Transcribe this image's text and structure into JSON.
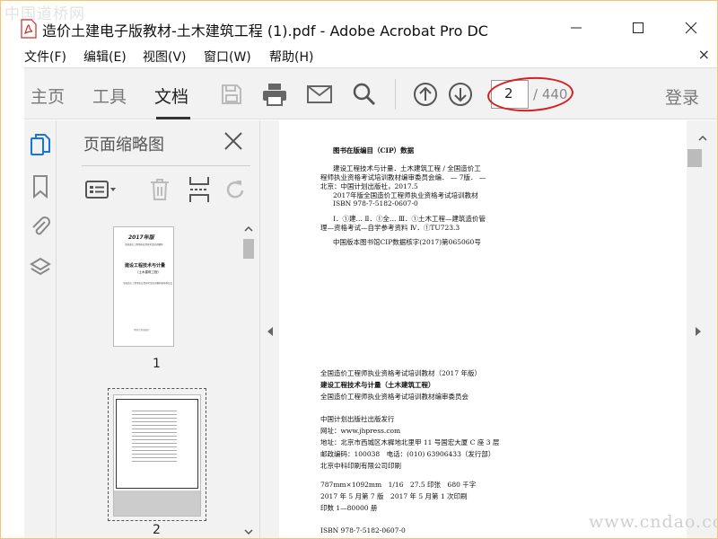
{
  "watermark_top": "中国道桥网",
  "watermark_bottom": "www.cndao.com",
  "window": {
    "title": "造价土建电子版教材-土木建筑工程 (1).pdf - Adobe Acrobat Pro DC"
  },
  "menu": [
    {
      "label": "文件(F)"
    },
    {
      "label": "编辑(E)"
    },
    {
      "label": "视图(V)"
    },
    {
      "label": "窗口(W)"
    },
    {
      "label": "帮助(H)"
    }
  ],
  "menu_close": "×",
  "toolbar": {
    "tabs": [
      {
        "label": "主页"
      },
      {
        "label": "工具"
      },
      {
        "label": "文档"
      }
    ],
    "active_tab": "文档",
    "page_value": "2",
    "page_total": "/ 440",
    "login_label": "登录"
  },
  "sidebar": {
    "title": "页面缩略图"
  },
  "thumbnails": [
    {
      "number": "1",
      "lines": {
        "year": "2017年版",
        "series": "全国造价工程师执业资格考试培训教材",
        "title": "建设工程技术与计量",
        "subtitle": "（土木建筑工程）",
        "note": "全国造价工程师执业资格考试培训教材编审委员会",
        "publisher": "中国计划出版社"
      }
    },
    {
      "number": "2"
    }
  ],
  "document": {
    "lines": [
      "图书在版编目（CIP）数据",
      "建设工程技术与计量．土木建筑工程 / 全国造价工",
      "程师执业资格考试培训教材编审委员会编． — 7版． —",
      "北京：中国计划出版社，2017.5",
      "2017年版全国造价工程师执业资格考试培训教材",
      "ISBN 978-7-5182-0607-0",
      "Ⅰ．①建… Ⅱ．①全… Ⅲ．①土木工程—建筑造价管",
      "理—资格考试—自学参考资料 Ⅳ．①TU723.3",
      "中国版本图书馆CIP数据核字(2017)第065060号",
      "全国造价工程师执业资格考试培训教材（2017 年版）",
      "建设工程技术与计量（土木建筑工程）",
      "全国造价工程师执业资格考试培训教材编审委员会",
      "中国计划出版社出版发行",
      "网址：www.jhpress.com",
      "地址：北京市西城区木樨地北里甲 11 号国宏大厦 C 座 3 层",
      "邮政编码：100038　电话：(010) 63906433（发行部）",
      "北京中科印刷有限公司印刷",
      "787mm×1092mm　1/16　27.5 印张　680 千字",
      "2017 年 5 月第 7 版　2017 年 5 月第 1 次印刷",
      "印数 1—80000 册",
      "ISBN 978-7-5182-0607-0"
    ]
  },
  "colors": {
    "accent": "#1473e6",
    "highlight_ring": "#d81e1e",
    "toolbar_bg": "#f2f2f2"
  }
}
